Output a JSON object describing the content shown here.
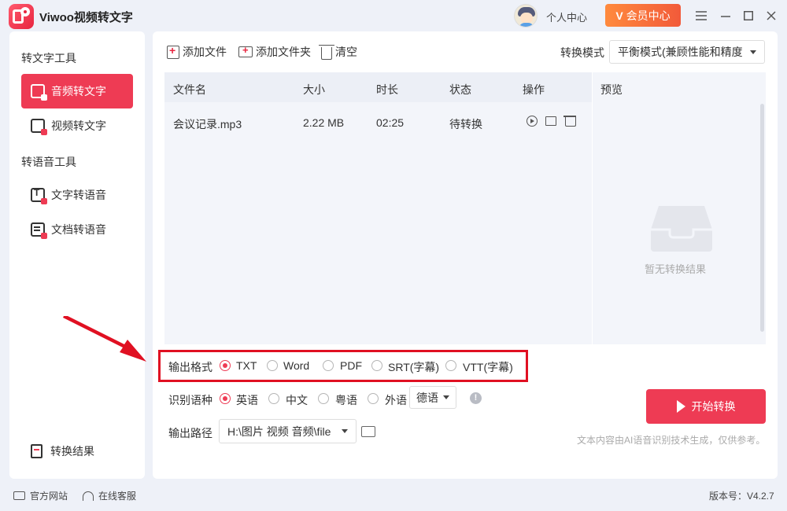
{
  "app": {
    "title": "Viwoo视频转文字",
    "user_center": "个人中心",
    "vip_label": "会员中心",
    "vip_icon_letter": "V",
    "window_controls": [
      "menu-icon",
      "minimize-icon",
      "maximize-icon",
      "close-icon"
    ]
  },
  "sidebar": {
    "text_tools_title": "转文字工具",
    "items_text": [
      {
        "label": "音频转文字",
        "icon": "audio-text-icon",
        "active": true
      },
      {
        "label": "视频转文字",
        "icon": "video-text-icon",
        "active": false
      }
    ],
    "voice_tools_title": "转语音工具",
    "items_voice": [
      {
        "label": "文字转语音",
        "icon": "text-to-speech-icon",
        "active": false
      },
      {
        "label": "文档转语音",
        "icon": "document-to-speech-icon",
        "active": false
      }
    ],
    "result_label": "转换结果"
  },
  "toolbar": {
    "add_file": "添加文件",
    "add_folder": "添加文件夹",
    "clear": "清空",
    "mode_label": "转换模式",
    "mode_value": "平衡模式(兼顾性能和精度"
  },
  "table": {
    "headers": [
      "文件名",
      "大小",
      "时长",
      "状态",
      "操作"
    ],
    "rows": [
      {
        "name": "会议记录.mp3",
        "size": "2.22 MB",
        "duration": "02:25",
        "status": "待转换"
      }
    ]
  },
  "preview": {
    "title": "预览",
    "empty_text": "暂无转换结果"
  },
  "output_format": {
    "label": "输出格式",
    "options": [
      "TXT",
      "Word",
      "PDF",
      "SRT(字幕)",
      "VTT(字幕)"
    ],
    "selected": "TXT"
  },
  "language": {
    "label": "识别语种",
    "options": [
      "英语",
      "中文",
      "粤语",
      "外语"
    ],
    "selected": "英语",
    "foreign_value": "德语",
    "info_symbol": "!"
  },
  "output_path": {
    "label": "输出路径",
    "value": "H:\\图片 视频 音频\\file"
  },
  "actions": {
    "start": "开始转换",
    "disclaimer": "文本内容由AI语音识别技术生成，仅供参考。"
  },
  "statusbar": {
    "website": "官方网站",
    "support": "在线客服",
    "version": "版本号：V4.2.7"
  },
  "colors": {
    "accent": "#ee3b54",
    "vip_gradient_start": "#ff8a3d",
    "vip_gradient_end": "#f25a3a",
    "highlight_box": "#e01022",
    "background": "#eef1f8"
  }
}
